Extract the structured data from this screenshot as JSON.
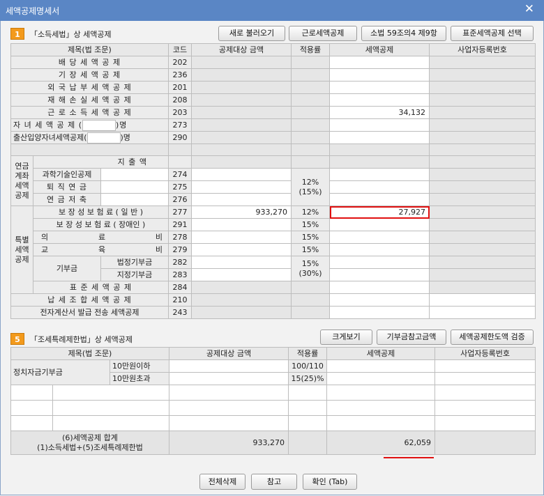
{
  "window": {
    "title": "세액공제명세서"
  },
  "section1": {
    "badge": "1",
    "title": "「소득세법」상 세액공제",
    "buttons": {
      "reload": "새로 불러오기",
      "earned": "근로세액공제",
      "law": "소법 59조의4 제9항",
      "standard": "표준세액공제 선택"
    },
    "headers": [
      "제목(법 조문)",
      "코드",
      "공제대상 금액",
      "적용률",
      "세액공제",
      "사업자등록번호"
    ],
    "rows": {
      "dividend": {
        "label": "배 당 세 액 공 제",
        "code": "202"
      },
      "bookkeeping": {
        "label": "기 장 세 액 공 제",
        "code": "236"
      },
      "foreign": {
        "label": "외 국 납 부 세 액 공 제",
        "code": "201"
      },
      "disaster": {
        "label": "재 해 손 실 세 액 공 제",
        "code": "208"
      },
      "earned": {
        "label": "근 로 소 득 세 액 공 제",
        "code": "203",
        "credit": "34,132"
      },
      "child": {
        "label_a": "자 녀 세 액 공 제 (",
        "label_b": ")명",
        "code": "273"
      },
      "birth": {
        "label_a": "출산입양자녀세액공제(",
        "label_b": ")명",
        "code": "290"
      },
      "pension": {
        "group": "연금계좌세액공제",
        "subheader": "지 출 액",
        "rate": "12%\n(15%)",
        "items": [
          {
            "label": "과학기술인공제",
            "code": "274"
          },
          {
            "label": "퇴 직 연 금",
            "code": "275"
          },
          {
            "label": "연 금 저 축",
            "code": "276"
          }
        ]
      },
      "special": {
        "group": "특별세액공제",
        "insurance": {
          "label": "보 장 성 보 험 료 ( 일 반 )",
          "code": "277",
          "amount": "933,270",
          "rate": "12%",
          "credit": "27,927"
        },
        "insurance_dis": {
          "label": "보 장 성 보 험 료 ( 장애인 )",
          "code": "291",
          "rate": "15%"
        },
        "medical": {
          "label_a": "의",
          "label_b": "료",
          "label_c": "비",
          "code": "278",
          "rate": "15%"
        },
        "education": {
          "label_a": "교",
          "label_b": "육",
          "label_c": "비",
          "code": "279",
          "rate": "15%"
        },
        "donation": {
          "label": "기부금",
          "statutory": "법정기부금",
          "statutory_code": "282",
          "designated": "지정기부금",
          "designated_code": "283",
          "rate": "15%\n(30%)"
        },
        "standard": {
          "label": "표 준 세 액 공 제",
          "code": "284"
        }
      },
      "union": {
        "label": "납 세 조 합 세 액 공 제",
        "code": "210"
      },
      "einvoice": {
        "label": "전자계산서 발급 전송 세액공제",
        "code": "243"
      }
    }
  },
  "section5": {
    "badge": "5",
    "title": "「조세특례제한법」상 세액공제",
    "buttons": {
      "enlarge": "크게보기",
      "donation_ref": "기부금참고금액",
      "verify": "세액공제한도액 검증"
    },
    "headers": [
      "제목(법 조문)",
      "공제대상 금액",
      "적용률",
      "세액공제",
      "사업자등록번호"
    ],
    "political": {
      "label": "정치자금기부금",
      "under": "10만원이하",
      "under_rate": "100/110",
      "over": "10만원초과",
      "over_rate": "15(25)%"
    },
    "total": {
      "label_1": "(6)세액공제 합계",
      "label_2": "(1)소득세법+(5)조세특례제한법",
      "amount": "933,270",
      "credit": "62,059"
    }
  },
  "footer": {
    "delete_all": "전체삭제",
    "reference": "참고",
    "confirm": "확인 (Tab)"
  }
}
